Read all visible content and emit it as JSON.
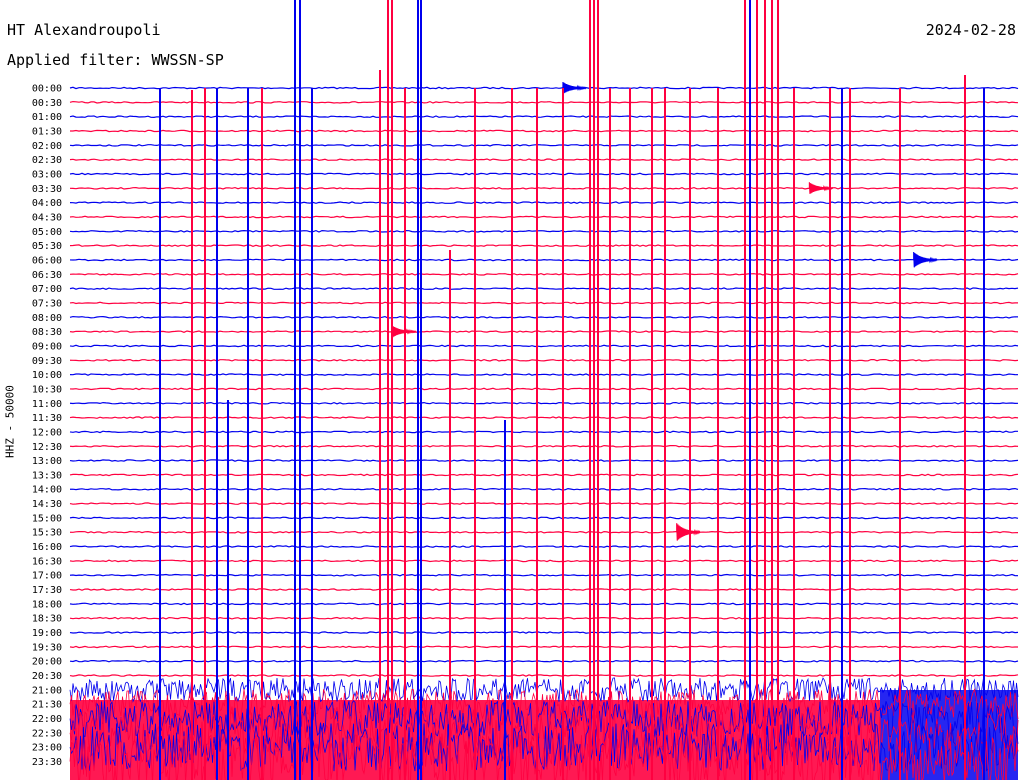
{
  "header": {
    "station": "HT Alexandroupoli",
    "date": "2024-02-28",
    "filter": "Applied filter: WWSSN-SP"
  },
  "colors": {
    "trace_a": "#0000ee",
    "trace_b": "#ff0040",
    "text": "#000000"
  },
  "chart_data": {
    "type": "line",
    "title": "HT Alexandroupoli",
    "ylabel": "HHZ - 50000",
    "rows": [
      "00:00",
      "00:30",
      "01:00",
      "01:30",
      "02:00",
      "02:30",
      "03:00",
      "03:30",
      "04:00",
      "04:30",
      "05:00",
      "05:30",
      "06:00",
      "06:30",
      "07:00",
      "07:30",
      "08:00",
      "08:30",
      "09:00",
      "09:30",
      "10:00",
      "10:30",
      "11:00",
      "11:30",
      "12:00",
      "12:30",
      "13:00",
      "13:30",
      "14:00",
      "14:30",
      "15:00",
      "15:30",
      "16:00",
      "16:30",
      "17:00",
      "17:30",
      "18:00",
      "18:30",
      "19:00",
      "19:30",
      "20:00",
      "20:30",
      "21:00",
      "21:30",
      "22:00",
      "22:30",
      "23:00",
      "23:30"
    ],
    "series": [
      {
        "color": "#0000ee",
        "rows": "even"
      },
      {
        "color": "#ff0040",
        "rows": "odd"
      }
    ],
    "events": [
      {
        "row": "00:00",
        "x_fraction": 0.52,
        "amp": 6
      },
      {
        "row": "03:30",
        "x_fraction": 0.78,
        "amp": 6
      },
      {
        "row": "06:00",
        "x_fraction": 0.89,
        "amp": 8
      },
      {
        "row": "08:30",
        "x_fraction": 0.34,
        "amp": 6
      },
      {
        "row": "15:30",
        "x_fraction": 0.64,
        "amp": 9
      }
    ]
  }
}
